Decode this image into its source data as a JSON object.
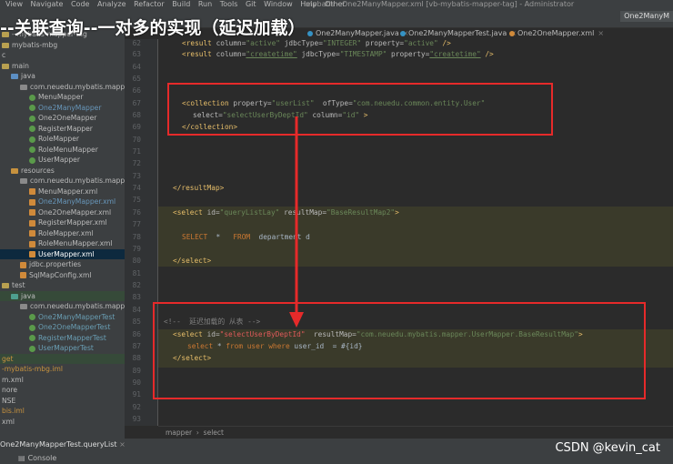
{
  "menubar": {
    "items": [
      "View",
      "Navigate",
      "Code",
      "Analyze",
      "Refactor",
      "Build",
      "Run",
      "Tools",
      "Git",
      "Window",
      "Help",
      "Other"
    ],
    "window_title": "mybatis - One2ManyMapper.xml [vb-mybatis-mapper-tag] - Administrator"
  },
  "overlay_title": "--关联查询--一对多的实现（延迟加载）",
  "editor_tabs": [
    {
      "label": "One2ManyMapper.java",
      "active": false
    },
    {
      "label": "One2ManyMapperTest.java",
      "active": false
    },
    {
      "label": "One2OneMapper.xml",
      "active": false
    }
  ],
  "right_button": "One2ManyM",
  "project_tree": [
    {
      "label": "--mybatis-mapper-tag",
      "color": "plain",
      "icon": "folder",
      "indent": 0
    },
    {
      "label": "mybatis-mbg",
      "color": "plain",
      "icon": "folder",
      "indent": 0
    },
    {
      "label": "c",
      "color": "plain",
      "icon": "",
      "indent": 0
    },
    {
      "label": "main",
      "color": "plain",
      "icon": "folder",
      "indent": 0
    },
    {
      "label": "java",
      "color": "plain",
      "icon": "folderblue",
      "indent": 1
    },
    {
      "label": "com.neuedu.mybatis.mapper",
      "color": "plain",
      "icon": "pkg",
      "indent": 2
    },
    {
      "label": "MenuMapper",
      "color": "plain",
      "icon": "class",
      "indent": 3
    },
    {
      "label": "One2ManyMapper",
      "color": "blue",
      "icon": "class",
      "indent": 3
    },
    {
      "label": "One2OneMapper",
      "color": "plain",
      "icon": "class",
      "indent": 3
    },
    {
      "label": "RegisterMapper",
      "color": "plain",
      "icon": "class",
      "indent": 3
    },
    {
      "label": "RoleMapper",
      "color": "plain",
      "icon": "class",
      "indent": 3
    },
    {
      "label": "RoleMenuMapper",
      "color": "plain",
      "icon": "class",
      "indent": 3
    },
    {
      "label": "UserMapper",
      "color": "plain",
      "icon": "class",
      "indent": 3
    },
    {
      "label": "resources",
      "color": "plain",
      "icon": "folderorange",
      "indent": 1
    },
    {
      "label": "com.neuedu.mybatis.mapper",
      "color": "plain",
      "icon": "pkg",
      "indent": 2
    },
    {
      "label": "MenuMapper.xml",
      "color": "plain",
      "icon": "xml",
      "indent": 3
    },
    {
      "label": "One2ManyMapper.xml",
      "color": "blue",
      "icon": "xml",
      "indent": 3
    },
    {
      "label": "One2OneMapper.xml",
      "color": "plain",
      "icon": "xml",
      "indent": 3
    },
    {
      "label": "RegisterMapper.xml",
      "color": "plain",
      "icon": "xml",
      "indent": 3
    },
    {
      "label": "RoleMapper.xml",
      "color": "plain",
      "icon": "xml",
      "indent": 3
    },
    {
      "label": "RoleMenuMapper.xml",
      "color": "plain",
      "icon": "xml",
      "indent": 3
    },
    {
      "label": "UserMapper.xml",
      "color": "white",
      "icon": "xml",
      "indent": 3,
      "selected": true
    },
    {
      "label": "jdbc.properties",
      "color": "plain",
      "icon": "xml",
      "indent": 2
    },
    {
      "label": "SqlMapConfig.xml",
      "color": "plain",
      "icon": "xml",
      "indent": 2
    },
    {
      "label": "test",
      "color": "plain",
      "icon": "folder",
      "indent": 0
    },
    {
      "label": "java",
      "color": "plain",
      "icon": "folderteal",
      "indent": 1,
      "highlight": true
    },
    {
      "label": "com.neuedu.mybatis.mapper",
      "color": "plain",
      "icon": "pkg",
      "indent": 2
    },
    {
      "label": "One2ManyMapperTest",
      "color": "cyan",
      "icon": "class",
      "indent": 3
    },
    {
      "label": "One2OneMapperTest",
      "color": "cyan",
      "icon": "class",
      "indent": 3
    },
    {
      "label": "RegisterMapperTest",
      "color": "cyan",
      "icon": "class",
      "indent": 3
    },
    {
      "label": "UserMapperTest",
      "color": "cyan",
      "icon": "class",
      "indent": 3
    },
    {
      "label": "get",
      "color": "orange",
      "icon": "",
      "indent": 0,
      "highlight": true
    },
    {
      "label": "-mybatis-mbg.iml",
      "color": "orange",
      "icon": "",
      "indent": 0
    },
    {
      "label": "m.xml",
      "color": "plain",
      "icon": "",
      "indent": 0
    },
    {
      "label": "nore",
      "color": "plain",
      "icon": "",
      "indent": 0
    },
    {
      "label": "NSE",
      "color": "plain",
      "icon": "",
      "indent": 0
    },
    {
      "label": "bis.iml",
      "color": "orange",
      "icon": "",
      "indent": 0
    },
    {
      "label": "xml",
      "color": "plain",
      "icon": "",
      "indent": 0
    }
  ],
  "line_numbers": [
    "62",
    "63",
    "64",
    "65",
    "66",
    "67",
    "68",
    "69",
    "70",
    "71",
    "72",
    "73",
    "74",
    "75",
    "76",
    "77",
    "78",
    "79",
    "80",
    "81",
    "82",
    "83",
    "84",
    "85",
    "86",
    "87",
    "88",
    "89",
    "90",
    "91",
    "92",
    "93"
  ],
  "code": {
    "l62": {
      "a": "<result ",
      "b": "column=",
      "c": "\"active\"",
      "d": " jdbcType=",
      "e": "\"INTEGER\"",
      "f": " property=",
      "g": "\"active\"",
      "h": " />"
    },
    "l63": {
      "a": "<result ",
      "b": "column=",
      "c": "\"createtime\"",
      "d": " jdbcType=",
      "e": "\"TIMESTAMP\"",
      "f": " property=",
      "g": "\"createtime\"",
      "h": " />"
    },
    "l67": {
      "a": "<collection ",
      "b": "property=",
      "c": "\"userList\"",
      "d": "  ofType=",
      "e": "\"com.neuedu.common.entity.User\""
    },
    "l68": {
      "b": "select=",
      "c": "\"selectUserByDeptId\"",
      "d": " column=",
      "e": "\"id\"",
      "h": " >"
    },
    "l69": {
      "a": "</collection>"
    },
    "l75": {
      "a": "</resultMap>"
    },
    "l77": {
      "a": "<select ",
      "b": "id=",
      "c": "\"queryListLay\"",
      "d": " resultMap=",
      "e": "\"BaseResultMap2\"",
      "h": ">"
    },
    "l79": {
      "a": "SELECT",
      "b": "  *   ",
      "c": "FROM",
      "d": "  department d"
    },
    "l81": {
      "a": "</select>"
    },
    "l86": {
      "a": "<!--  延迟加载的 从表 -->"
    },
    "l87": {
      "a": "<select ",
      "b": "id=",
      "c": "\"selectUserByDeptId\"",
      "d": "  resultMap=",
      "e": "\"com.neuedu.mybatis.mapper.UserMapper.BaseResultMap\"",
      "h": ">"
    },
    "l88": {
      "a": "select",
      "b": " * ",
      "c": "from",
      "d": " user ",
      "e": "where",
      "f": " user_id  = #{id}"
    },
    "l89": {
      "a": "</select>"
    }
  },
  "breadcrumb": [
    "mapper",
    "select"
  ],
  "run_tab": "One2ManyMapperTest.queryList",
  "console_label": "Console",
  "watermark": "CSDN @kevin_cat",
  "colors": {
    "annotation_red": "#e62a2a",
    "tag": "#e8bf6a",
    "string": "#6a8759",
    "keyword": "#cc7832"
  }
}
